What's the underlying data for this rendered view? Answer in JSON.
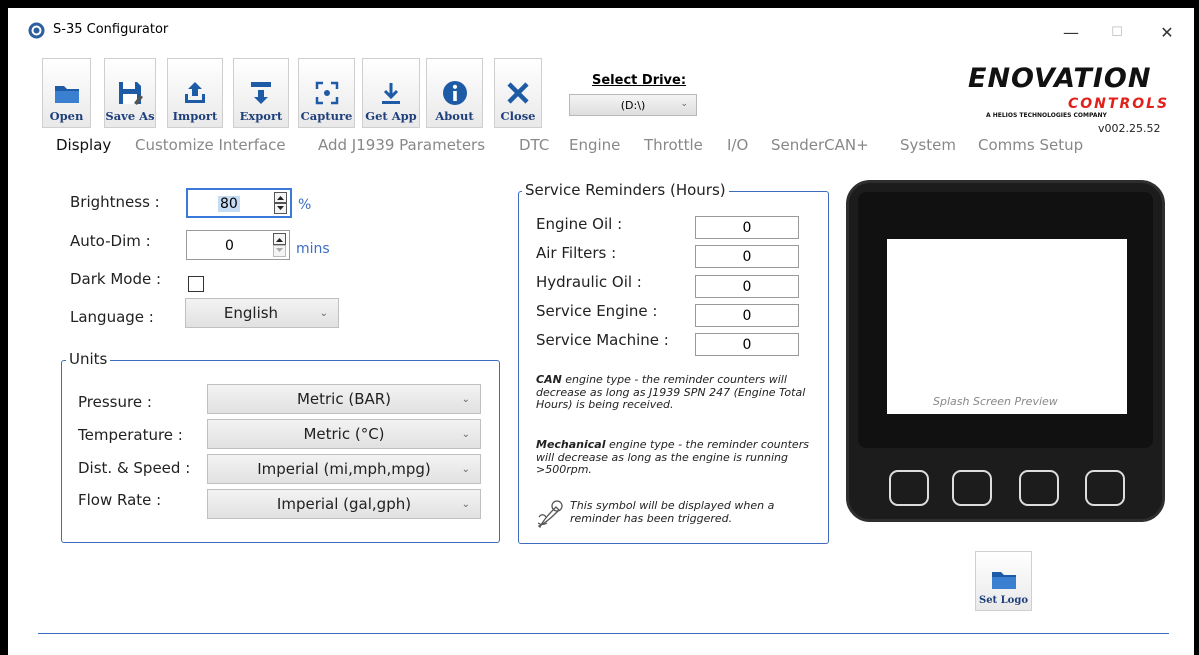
{
  "window": {
    "title": "S-35 Configurator",
    "minimize": "—",
    "maximize": "☐",
    "close": "✕"
  },
  "toolbar": {
    "open": "Open",
    "save_as": "Save As",
    "import": "Import",
    "export": "Export",
    "capture": "Capture",
    "get_app": "Get App",
    "about": "About",
    "close": "Close"
  },
  "drive": {
    "label": "Select Drive:",
    "value": "(D:\\)"
  },
  "brand": {
    "line1": "ENOVATION",
    "line2": "CONTROLS",
    "line3": "A HELIOS TECHNOLOGIES COMPANY",
    "version": "v002.25.52"
  },
  "tabs": [
    "Display",
    "Customize Interface",
    "Add J1939 Parameters",
    "DTC",
    "Engine",
    "Throttle",
    "I/O",
    "SenderCAN+",
    "System",
    "Comms Setup"
  ],
  "display": {
    "brightness_label": "Brightness :",
    "brightness_value": "80",
    "brightness_unit": "%",
    "autodim_label": "Auto-Dim :",
    "autodim_value": "0",
    "autodim_unit": "mins",
    "darkmode_label": "Dark Mode :",
    "language_label": "Language :",
    "language_value": "English"
  },
  "units": {
    "title": "Units",
    "pressure_label": "Pressure :",
    "pressure_value": "Metric (BAR)",
    "temperature_label": "Temperature :",
    "temperature_value": "Metric (°C)",
    "dist_label": "Dist. & Speed :",
    "dist_value": "Imperial (mi,mph,mpg)",
    "flow_label": "Flow Rate :",
    "flow_value": "Imperial (gal,gph)"
  },
  "service": {
    "title": "Service Reminders (Hours)",
    "items": [
      {
        "label": "Engine Oil :",
        "value": "0"
      },
      {
        "label": "Air Filters :",
        "value": "0"
      },
      {
        "label": "Hydraulic Oil :",
        "value": "0"
      },
      {
        "label": "Service Engine :",
        "value": "0"
      },
      {
        "label": "Service Machine :",
        "value": "0"
      }
    ],
    "can_bold": "CAN",
    "can_text": " engine type - the reminder counters will decrease as long as J1939 SPN 247 (Engine Total Hours) is being received.",
    "mech_bold": "Mechanical",
    "mech_text": " engine type - the reminder counters will decrease as long as the engine is running >500rpm.",
    "symbol_text": "This symbol will be displayed when a reminder has been triggered."
  },
  "preview": {
    "splash_label": "Splash Screen Preview",
    "set_logo": "Set Logo"
  }
}
